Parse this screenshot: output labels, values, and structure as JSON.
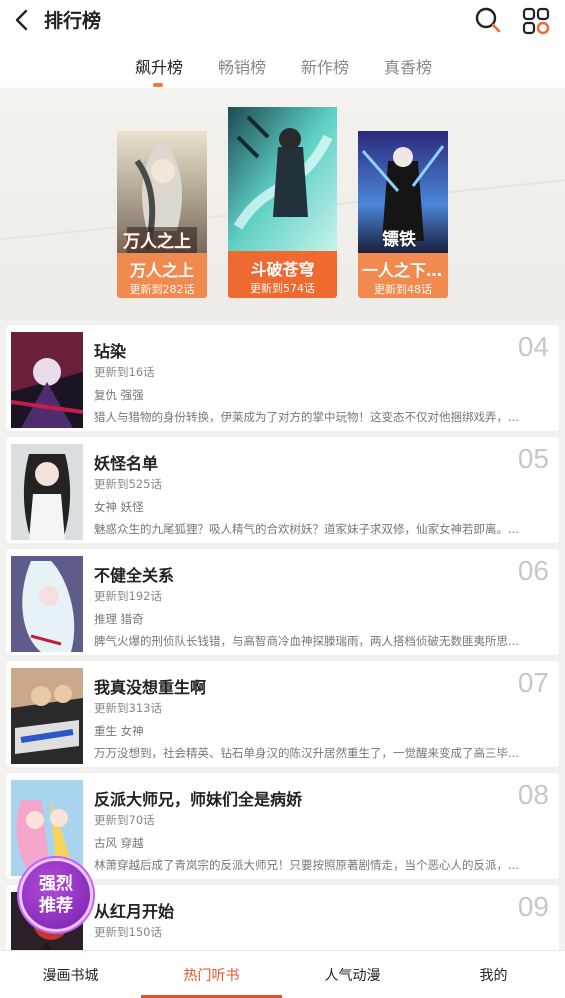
{
  "header": {
    "title": "排行榜",
    "back_icon": "chevron-left-icon",
    "search_icon": "search-icon",
    "grid_icon": "grid-icon"
  },
  "tabs": [
    {
      "label": "飙升榜",
      "active": true
    },
    {
      "label": "畅销榜",
      "active": false
    },
    {
      "label": "新作榜",
      "active": false
    },
    {
      "label": "真香榜",
      "active": false
    }
  ],
  "podium": [
    {
      "rank": 2,
      "title": "万人之上",
      "update": "更新到282话",
      "cover_text": "万人之上"
    },
    {
      "rank": 1,
      "title": "斗破苍穹",
      "update": "更新到574话",
      "cover_text": ""
    },
    {
      "rank": 3,
      "title": "一人之下...",
      "update": "更新到48话",
      "cover_text": "镖铁"
    }
  ],
  "list": [
    {
      "rank": "04",
      "title": "玷染",
      "update": "更新到16话",
      "tags": "复仇 强强",
      "desc": "猎人与猎物的身份转换，伊莱成为了对方的掌中玩物！这变态不仅对他捆绑戏弄，..."
    },
    {
      "rank": "05",
      "title": "妖怪名单",
      "update": "更新到525话",
      "tags": "女神 妖怪",
      "desc": "魅惑众生的九尾狐狸？吸人精气的合欢树妖？道家妹子求双修，仙家女神若即离。..."
    },
    {
      "rank": "06",
      "title": "不健全关系",
      "update": "更新到192话",
      "tags": "推理 猎奇",
      "desc": "脾气火爆的刑侦队长钱错，与高智商冷血神探滕瑞雨，两人搭档侦破无数匪夷所思..."
    },
    {
      "rank": "07",
      "title": "我真没想重生啊",
      "update": "更新到313话",
      "tags": "重生 女神",
      "desc": "万万没想到，社会精英、钻石单身汉的陈汉升居然重生了，一觉醒来变成了高三毕..."
    },
    {
      "rank": "08",
      "title": "反派大师兄，师妹们全是病娇",
      "update": "更新到70话",
      "tags": "古风 穿越",
      "desc": "林萧穿越后成了青岚宗的反派大师兄！只要按照原著剧情走，当个恶心人的反派，..."
    },
    {
      "rank": "09",
      "title": "从红月开始",
      "update": "更新到150话",
      "tags": "",
      "desc": ""
    }
  ],
  "promo_badge": {
    "line1": "强烈",
    "line2": "推荐"
  },
  "bottom_nav": [
    {
      "label": "漫画书城",
      "active": false
    },
    {
      "label": "热门听书",
      "active": true
    },
    {
      "label": "人气动漫",
      "active": false
    },
    {
      "label": "我的",
      "active": false
    }
  ],
  "colors": {
    "accent": "#e0542a",
    "podium_label": "#f08a4f",
    "podium_label_center": "#ee6a31"
  }
}
